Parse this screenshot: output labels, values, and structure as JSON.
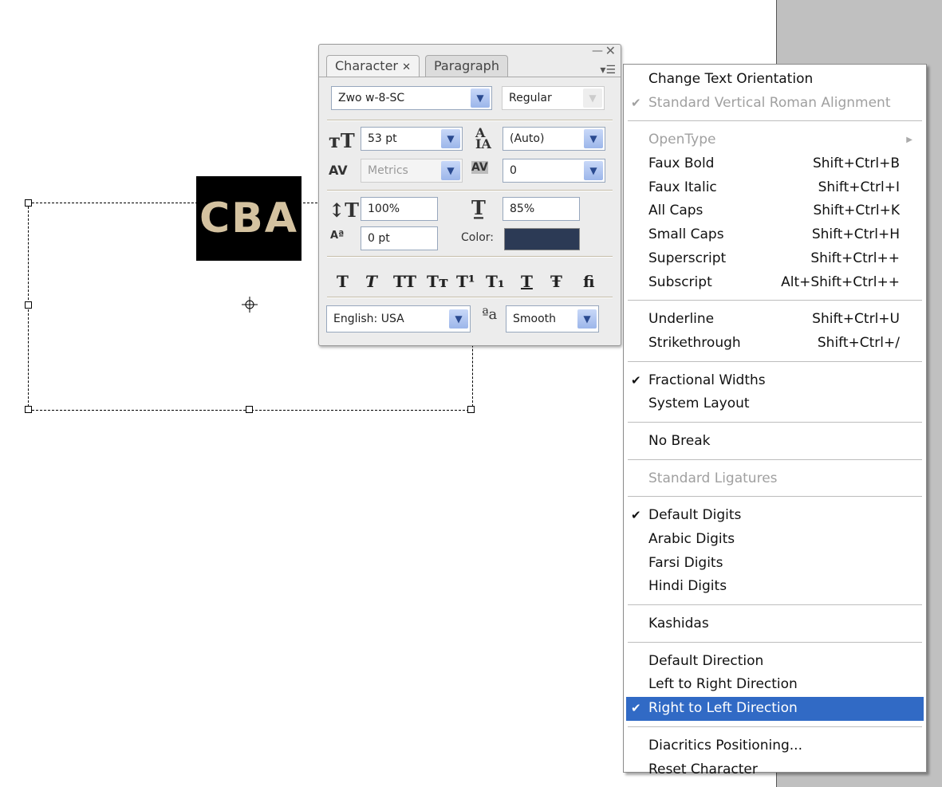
{
  "canvas": {
    "sample_text": "CBA"
  },
  "panel": {
    "tabs": [
      "Character",
      "Paragraph"
    ],
    "font_family": "Zwo w-8-SC",
    "font_style": "Regular",
    "font_size": "53 pt",
    "leading": "(Auto)",
    "kerning": "Metrics",
    "tracking": "0",
    "vertical_scale": "100%",
    "horizontal_scale": "85%",
    "baseline_shift": "0 pt",
    "color_label": "Color:",
    "color_value": "#2c3a55",
    "style_buttons": [
      "T",
      "T",
      "TT",
      "Tт",
      "T¹",
      "T₁",
      "T",
      "Ŧ",
      "ﬁ"
    ],
    "language": "English: USA",
    "antialias_icon": "ªa",
    "antialias": "Smooth"
  },
  "menu": {
    "groups": [
      [
        {
          "label": "Change Text Orientation"
        },
        {
          "label": "Standard Vertical Roman Alignment",
          "checked": true,
          "disabled": true
        }
      ],
      [
        {
          "label": "OpenType",
          "disabled": true,
          "submenu": true
        },
        {
          "label": "Faux Bold",
          "shortcut": "Shift+Ctrl+B"
        },
        {
          "label": "Faux Italic",
          "shortcut": "Shift+Ctrl+I"
        },
        {
          "label": "All Caps",
          "shortcut": "Shift+Ctrl+K"
        },
        {
          "label": "Small Caps",
          "shortcut": "Shift+Ctrl+H"
        },
        {
          "label": "Superscript",
          "shortcut": "Shift+Ctrl++"
        },
        {
          "label": "Subscript",
          "shortcut": "Alt+Shift+Ctrl++"
        }
      ],
      [
        {
          "label": "Underline",
          "shortcut": "Shift+Ctrl+U"
        },
        {
          "label": "Strikethrough",
          "shortcut": "Shift+Ctrl+/"
        }
      ],
      [
        {
          "label": "Fractional Widths",
          "checked": true
        },
        {
          "label": "System Layout"
        }
      ],
      [
        {
          "label": "No Break"
        }
      ],
      [
        {
          "label": "Standard Ligatures",
          "disabled": true
        }
      ],
      [
        {
          "label": "Default Digits",
          "checked": true
        },
        {
          "label": "Arabic Digits"
        },
        {
          "label": "Farsi Digits"
        },
        {
          "label": "Hindi Digits"
        }
      ],
      [
        {
          "label": "Kashidas"
        }
      ],
      [
        {
          "label": "Default Direction"
        },
        {
          "label": "Left to Right Direction"
        },
        {
          "label": "Right to Left Direction",
          "checked": true,
          "highlighted": true
        }
      ],
      [
        {
          "label": "Diacritics Positioning..."
        },
        {
          "label": "Reset Character"
        }
      ]
    ]
  }
}
